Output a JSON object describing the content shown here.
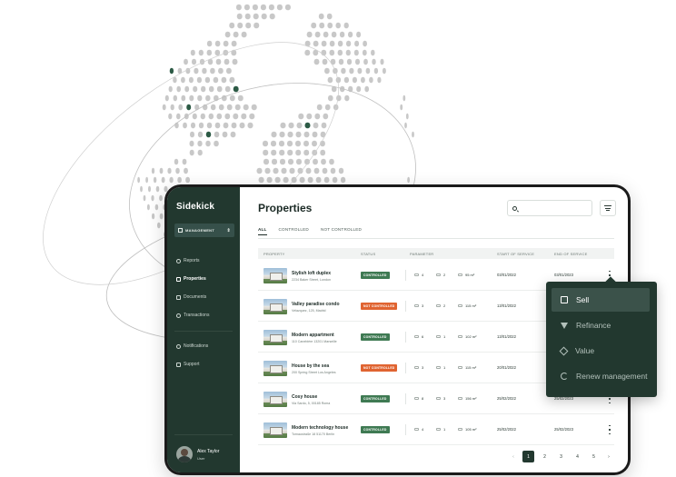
{
  "app": {
    "brand": "Sidekick"
  },
  "sidebar": {
    "workspace": "MANAGEMENT",
    "items": [
      {
        "label": "Reports",
        "active": false
      },
      {
        "label": "Properties",
        "active": true
      },
      {
        "label": "Documents",
        "active": false
      },
      {
        "label": "Transactions",
        "active": false
      },
      {
        "label": "Notifications",
        "active": false
      },
      {
        "label": "Support",
        "active": false
      }
    ],
    "user": {
      "name": "Alex Taylor",
      "role": "User"
    }
  },
  "page": {
    "title": "Properties"
  },
  "search": {
    "value": ""
  },
  "tabs": [
    {
      "label": "ALL",
      "active": true
    },
    {
      "label": "CONTROLLED",
      "active": false
    },
    {
      "label": "NOT CONTROLLED",
      "active": false
    }
  ],
  "table": {
    "headers": [
      "PROPERTY",
      "STATUS",
      "PARAMETER",
      "START OF SERVICE",
      "END OF SERVICE"
    ],
    "rows": [
      {
        "name": "Stylish loft duplex",
        "address": "2234 Baker Street, London",
        "status": "CONTROLLED",
        "beds": "4",
        "baths": "2",
        "area": "95 m²",
        "start": "03/01/2022",
        "end": "03/01/2023"
      },
      {
        "name": "Valley paradise condo",
        "address": "Velazquez, 125, Madrid",
        "status": "NOT CONTROLLED",
        "beds": "3",
        "baths": "2",
        "area": "115 m²",
        "start": "13/01/2022",
        "end": ""
      },
      {
        "name": "Modern appartment",
        "address": "110 Canebière 13201 Marseille",
        "status": "CONTROLLED",
        "beds": "6",
        "baths": "1",
        "area": "102 m²",
        "start": "13/01/2022",
        "end": ""
      },
      {
        "name": "House by the sea",
        "address": "200 Spring Street Los Angeles",
        "status": "NOT CONTROLLED",
        "beds": "3",
        "baths": "1",
        "area": "115 m²",
        "start": "20/01/2022",
        "end": ""
      },
      {
        "name": "Cosy house",
        "address": "Via Sardo, 5, 00185 Roma",
        "status": "CONTROLLED",
        "beds": "8",
        "baths": "3",
        "area": "156 m²",
        "start": "25/02/2022",
        "end": "25/02/2023"
      },
      {
        "name": "Modern technology house",
        "address": "Tornaustraße 18 51170 Berlin",
        "status": "CONTROLLED",
        "beds": "4",
        "baths": "1",
        "area": "105 m²",
        "start": "25/02/2022",
        "end": "25/02/2023"
      }
    ]
  },
  "pagination": {
    "pages": [
      "1",
      "2",
      "3",
      "4",
      "5"
    ],
    "current": "1",
    "prev": "‹",
    "next": "›"
  },
  "context_menu": {
    "items": [
      {
        "label": "Sell",
        "active": true
      },
      {
        "label": "Refinance",
        "active": false
      },
      {
        "label": "Value",
        "active": false
      },
      {
        "label": "Renew management",
        "active": false
      }
    ]
  },
  "colors": {
    "sidebar": "#22382f",
    "controlled": "#3f7a53",
    "not_controlled": "#e06431",
    "globe_dot": "#c8c8c8",
    "globe_accent": "#2c5a45"
  }
}
